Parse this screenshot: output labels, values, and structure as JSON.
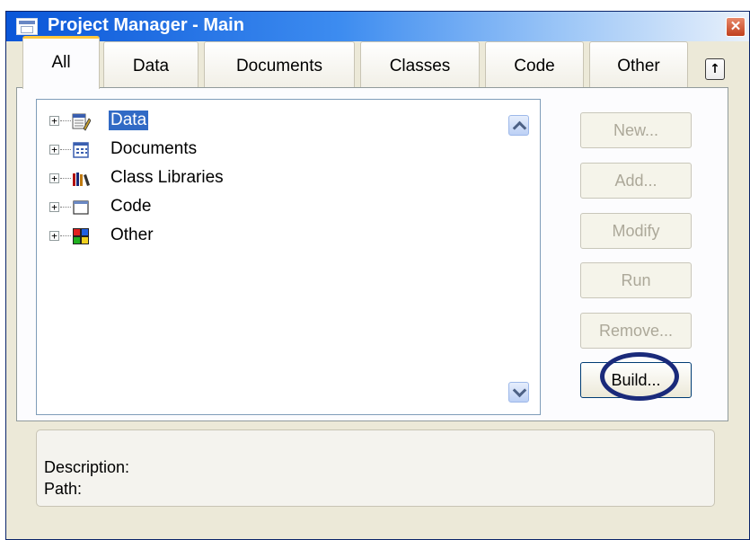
{
  "window": {
    "title": "Project Manager - Main",
    "close_glyph": "✕"
  },
  "tabs": [
    {
      "label": "All",
      "active": true
    },
    {
      "label": "Data"
    },
    {
      "label": "Documents"
    },
    {
      "label": "Classes"
    },
    {
      "label": "Code"
    },
    {
      "label": "Other"
    }
  ],
  "tab_scroll_glyph": "↑",
  "tree": {
    "items": [
      {
        "label": "Data",
        "selected": true,
        "icon": "data-icon",
        "expander": "+"
      },
      {
        "label": "Documents",
        "icon": "documents-icon",
        "expander": "+"
      },
      {
        "label": "Class Libraries",
        "icon": "class-libraries-icon",
        "expander": "+"
      },
      {
        "label": "Code",
        "icon": "code-icon",
        "expander": "+"
      },
      {
        "label": "Other",
        "icon": "other-icon",
        "expander": "+"
      }
    ]
  },
  "buttons": [
    {
      "label": "New...",
      "enabled": false
    },
    {
      "label": "Add...",
      "enabled": false
    },
    {
      "label": "Modify",
      "enabled": false
    },
    {
      "label": "Run",
      "enabled": false
    },
    {
      "label": "Remove...",
      "enabled": false
    },
    {
      "label": "Build...",
      "enabled": true
    }
  ],
  "description": {
    "description_label": "Description:",
    "path_label": "Path:"
  },
  "colors": {
    "selection": "#316ac5",
    "annotation_ring": "#1a2a7a",
    "active_tab_accent": "#ffc83c"
  }
}
